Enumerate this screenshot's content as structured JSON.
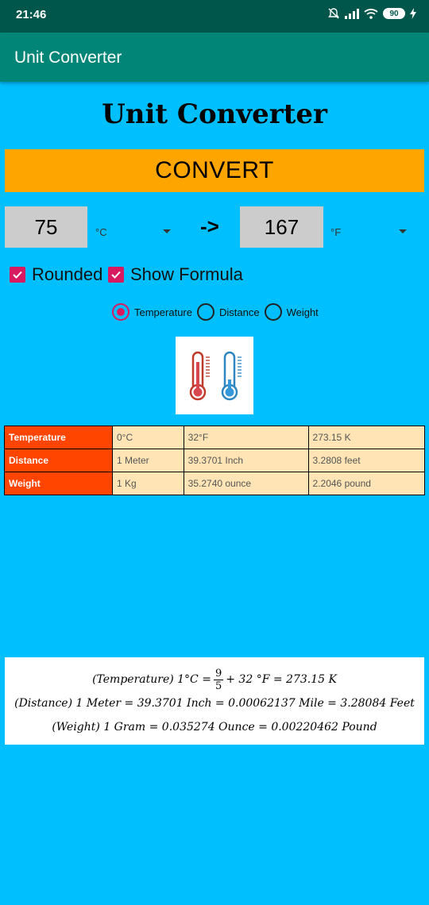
{
  "status_bar": {
    "time": "21:46",
    "battery": "90"
  },
  "app_bar": {
    "title": "Unit Converter"
  },
  "page": {
    "title": "Unit Converter"
  },
  "convert_button": {
    "label": "CONVERT"
  },
  "conversion": {
    "from_value": "75",
    "from_unit": "°C",
    "arrow": "->",
    "to_value": "167",
    "to_unit": "°F"
  },
  "options": {
    "rounded": {
      "label": "Rounded",
      "checked": true
    },
    "show_formula": {
      "label": "Show Formula",
      "checked": true
    }
  },
  "categories": [
    {
      "label": "Temperature",
      "selected": true
    },
    {
      "label": "Distance",
      "selected": false
    },
    {
      "label": "Weight",
      "selected": false
    }
  ],
  "table": {
    "rows": [
      {
        "name": "Temperature",
        "values": [
          "0°C",
          "32°F",
          "273.15 K"
        ]
      },
      {
        "name": "Distance",
        "values": [
          "1 Meter",
          "39.3701 Inch",
          "3.2808 feet"
        ]
      },
      {
        "name": "Weight",
        "values": [
          "1 Kg",
          "35.2740 ounce",
          "2.2046 pound"
        ]
      }
    ]
  },
  "formulas": {
    "temperature": {
      "prefix": "(Temperature)  1°C =",
      "numerator": "9",
      "denominator": "5",
      "suffix": "+ 32 °F = 273.15 K"
    },
    "distance": "(Distance) 1 Meter = 39.3701 Inch = 0.00062137 Mile =  3.28084 Feet",
    "weight": "(Weight) 1 Gram = 0.035274 Ounce = 0.00220462 Pound"
  },
  "colors": {
    "background": "#00BFFF",
    "status_bar": "#00564B",
    "app_bar": "#008577",
    "convert_button": "#FFA500",
    "accent": "#D81B60",
    "table_header": "#FF4500",
    "table_cell": "#FFE4B5"
  },
  "icons": [
    "mute-icon",
    "signal-icon",
    "wifi-icon",
    "battery-icon",
    "charging-icon",
    "thermometer-icon",
    "check-icon"
  ]
}
